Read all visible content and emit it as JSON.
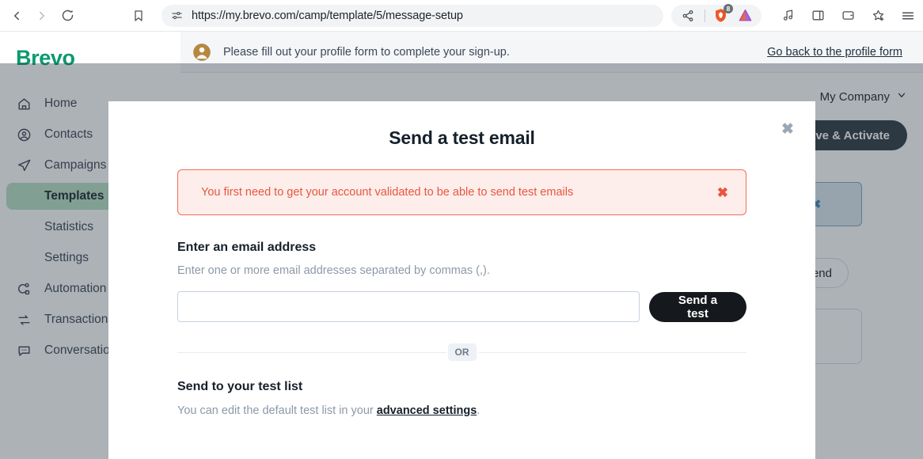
{
  "browser": {
    "url": "https://my.brevo.com/camp/template/5/message-setup",
    "back_label": "Back",
    "forward_label": "Forward",
    "reload_label": "Reload",
    "bookmark_label": "Bookmark this tab",
    "share_label": "Share",
    "brave_shields_label": "Brave Shields",
    "brave_shields_count": "8",
    "bat_label": "Brave Rewards",
    "music_label": "Media control",
    "sidebar_label": "Toggle sidebar",
    "wallet_label": "Brave Wallet",
    "bookmarks_label": "Bookmarks",
    "menu_label": "Customize and control Brave"
  },
  "app": {
    "brand": "Brevo",
    "sidebar": [
      {
        "label": "Home",
        "icon": "home-icon",
        "active": false,
        "sub": false
      },
      {
        "label": "Contacts",
        "icon": "contacts-icon",
        "active": false,
        "sub": false
      },
      {
        "label": "Campaigns",
        "icon": "campaigns-icon",
        "active": false,
        "sub": false
      },
      {
        "label": "Templates",
        "icon": "",
        "active": true,
        "sub": true
      },
      {
        "label": "Statistics",
        "icon": "",
        "active": false,
        "sub": true
      },
      {
        "label": "Settings",
        "icon": "",
        "active": false,
        "sub": true
      },
      {
        "label": "Automation",
        "icon": "automation-icon",
        "active": false,
        "sub": false
      },
      {
        "label": "Transactional",
        "icon": "transactional-icon",
        "active": false,
        "sub": false
      },
      {
        "label": "Conversations",
        "icon": "conversations-icon",
        "active": false,
        "sub": false
      }
    ],
    "banner": {
      "message": "Please fill out your profile form to complete your sign-up.",
      "link": "Go back to the profile form"
    },
    "company_selector": "My Company",
    "save_activate": "Save & Activate",
    "background_pill": "Send",
    "colors": {
      "brand_green": "#0b996e",
      "active_nav": "#b9e0c7",
      "alert_red": "#e9553f",
      "alert_bg": "#fdeeeb",
      "dark_button": "#15181c"
    }
  },
  "modal": {
    "title": "Send a test email",
    "close_label": "✖",
    "alert": {
      "message": "You first need to get your account validated to be able to send test emails",
      "close_label": "✖"
    },
    "email_section": {
      "title": "Enter an email address",
      "hint": "Enter one or more email addresses separated by commas (,).",
      "input_value": "",
      "input_placeholder": "",
      "send_button": "Send a test"
    },
    "divider_label": "OR",
    "test_list_section": {
      "title": "Send to your test list",
      "hint_before": "You can edit the default test list in your ",
      "hint_link": "advanced settings",
      "hint_after": "."
    }
  }
}
